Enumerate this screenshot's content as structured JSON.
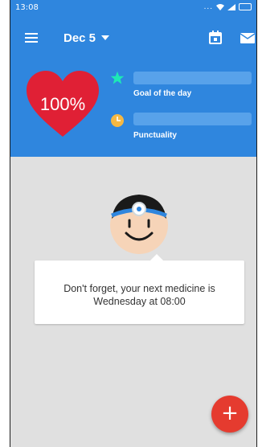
{
  "status_bar": {
    "time": "13:08",
    "signal_dots": "..."
  },
  "app_bar": {
    "date_label": "Dec 5"
  },
  "summary": {
    "health_percent_label": "100%",
    "goal_of_the_day": {
      "label": "Goal of the day",
      "progress": 0
    },
    "punctuality": {
      "label": "Punctuality",
      "progress": 0
    }
  },
  "reminder": {
    "line1": "Don't forget, your next medicine is",
    "line2": "Wednesday at 08:00"
  },
  "fab": {
    "label": "+"
  },
  "colors": {
    "app_blue": "#2f86de",
    "heart_red": "#e02035",
    "star_teal": "#1de9b6",
    "clock_orange": "#f5b843",
    "fab_red": "#e53b2f"
  }
}
